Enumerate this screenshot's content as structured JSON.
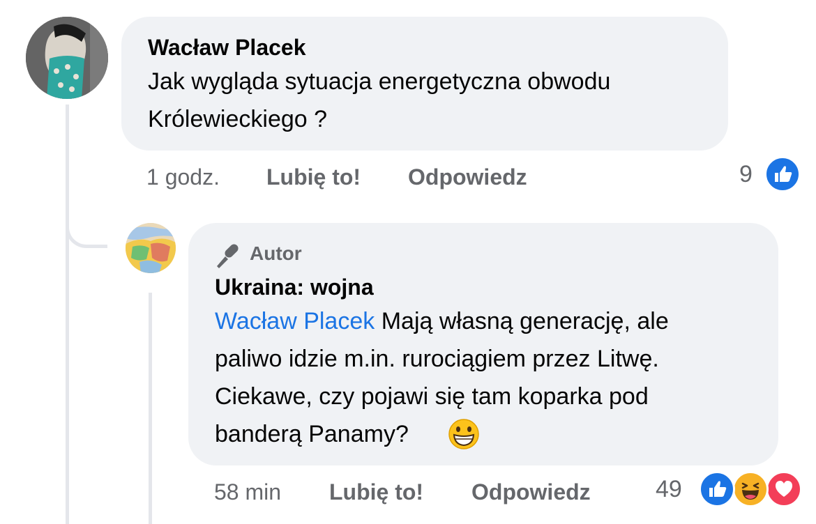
{
  "comment": {
    "author": "Wacław Placek",
    "text_line1": "Jak wygląda sytuacja energetyczna obwodu",
    "text_line2": "Królewieckiego ?",
    "time": "1 godz.",
    "like_label": "Lubię to!",
    "reply_label": "Odpowiedz",
    "reaction_count": "9",
    "reaction_icons": [
      "like-icon"
    ]
  },
  "reply": {
    "badge_icon": "microphone-icon",
    "badge_label": "Autor",
    "author": "Ukraina: wojna",
    "mention": "Wacław Placek",
    "text_line1": " Mają własną generację, ale",
    "text_line2": "paliwo idzie m.in. rurociągiem przez Litwę.",
    "text_line3": "Ciekawe, czy pojawi się tam koparka pod",
    "text_line4": "banderą Panamy? ",
    "emoji": "grinning-face-icon",
    "time": "58 min",
    "like_label": "Lubię to!",
    "reply_label": "Odpowiedz",
    "reaction_count": "49",
    "reaction_icons": [
      "like-icon",
      "haha-icon",
      "love-icon"
    ]
  },
  "colors": {
    "bubble": "#f0f2f5",
    "mention": "#1b74e4",
    "like": "#1b74e4",
    "love": "#f33e58",
    "haha": "#f7b125",
    "muted": "#65676b"
  }
}
